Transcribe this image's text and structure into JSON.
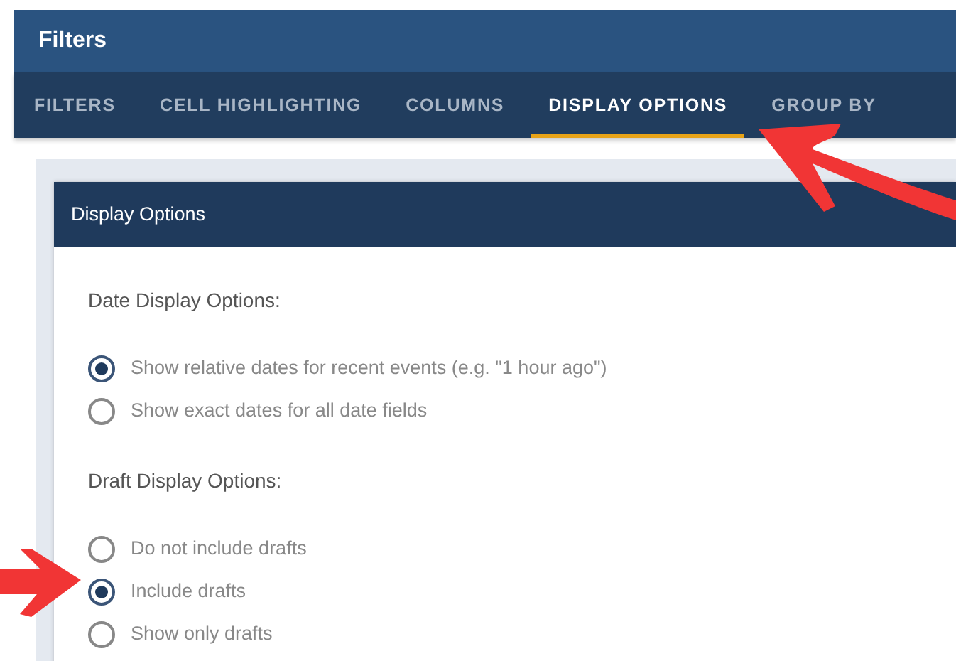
{
  "window": {
    "title": "Filters"
  },
  "tabs": [
    {
      "label": "FILTERS",
      "selected": false
    },
    {
      "label": "CELL HIGHLIGHTING",
      "selected": false
    },
    {
      "label": "COLUMNS",
      "selected": false
    },
    {
      "label": "DISPLAY OPTIONS",
      "selected": true
    },
    {
      "label": "GROUP BY",
      "selected": false
    }
  ],
  "panel": {
    "title": "Display Options",
    "groups": [
      {
        "label": "Date Display Options:",
        "options": [
          {
            "label": "Show relative dates for recent events (e.g. \"1 hour ago\")",
            "selected": true
          },
          {
            "label": "Show exact dates for all date fields",
            "selected": false
          }
        ]
      },
      {
        "label": "Draft Display Options:",
        "options": [
          {
            "label": "Do not include drafts",
            "selected": false
          },
          {
            "label": "Include drafts",
            "selected": true
          },
          {
            "label": "Show only drafts",
            "selected": false
          }
        ]
      }
    ]
  }
}
